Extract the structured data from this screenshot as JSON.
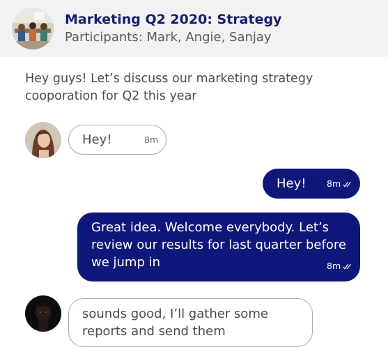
{
  "header": {
    "title": "Marketing Q2 2020: Strategy",
    "participants": "Participants: Mark, Angie, Sanjay"
  },
  "intro_text": "Hey guys! Let’s discuss our marketing strategy cooporation for Q2 this year",
  "messages": [
    {
      "direction": "incoming",
      "text": "Hey!",
      "time": "8m"
    },
    {
      "direction": "outgoing",
      "text": "Hey!",
      "time": "8m",
      "status": "read"
    },
    {
      "direction": "outgoing",
      "text": "Great idea. Welcome everybody. Let’s review our results for last quarter before we jump in",
      "time": "8m",
      "status": "read"
    },
    {
      "direction": "incoming",
      "text": "sounds good, I’ll gather some reports and send them"
    }
  ],
  "colors": {
    "header_bg": "#f2f2f2",
    "title": "#151e6b",
    "outgoing_bubble": "#10177a",
    "incoming_border": "#a9a9b2"
  }
}
